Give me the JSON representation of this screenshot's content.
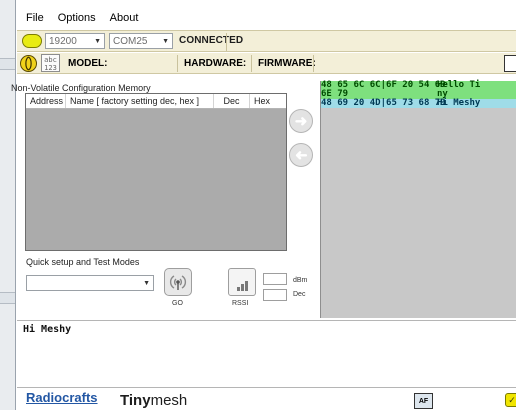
{
  "menubar": {
    "items": [
      "File",
      "Options",
      "About"
    ]
  },
  "toolbar1": {
    "baud_rate": "19200",
    "com_port": "COM25",
    "status": "CONNECTED",
    "led_color": "#e8ec12"
  },
  "toolbar2": {
    "abc_icon": "abc",
    "num_icon": "123",
    "model_label": "MODEL:",
    "hardware_label": "HARDWARE:",
    "firmware_label": "FIRMWARE:"
  },
  "nvm": {
    "title": "Non-Volatile Configuration Memory",
    "columns": [
      "Address",
      "Name  [ factory setting dec, hex ]",
      "Dec",
      "Hex"
    ]
  },
  "quick_setup": {
    "title": "Quick setup and Test Modes",
    "selected": "",
    "go_label": "GO",
    "rssi_label": "RSSI",
    "dbm_unit": "dBm",
    "dec_unit": "Dec"
  },
  "hex_terminal": {
    "rows": [
      {
        "hex": "48 65 6C 6C|6F 20 54 69",
        "ascii": "Hello Ti",
        "color": "green"
      },
      {
        "hex": "6E 79",
        "ascii": "ny",
        "color": "green"
      },
      {
        "hex": "48 69 20 4D|65 73 68 79",
        "ascii": "Hi Meshy",
        "color": "cyan"
      }
    ]
  },
  "ascii_console": {
    "text": "Hi Meshy"
  },
  "footer": {
    "brand1": "Radiocrafts",
    "brand2_bold": "Tiny",
    "brand2_light": "mesh",
    "af_icon": "AF",
    "ok_icon": "✓"
  }
}
